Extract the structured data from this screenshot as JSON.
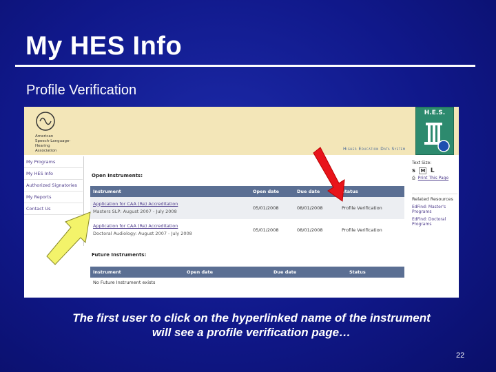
{
  "slide": {
    "title": "My HES Info",
    "subtitle": "Profile Verification",
    "caption_line1": "The first user to click on the hyperlinked name of the instrument",
    "caption_line2": "will see a profile verification page…",
    "page_number": "22"
  },
  "screenshot": {
    "org_text": [
      "American",
      "Speech-Language-",
      "Hearing",
      "Association"
    ],
    "tagline": "Higher Education Data System",
    "hes_logo": "H.E.S.",
    "sidebar": [
      "My Programs",
      "My HES Info",
      "Authorized Signatories",
      "My Reports",
      "Contact Us"
    ],
    "open_label": "Open Instruments:",
    "open_headers": [
      "Instrument",
      "Open date",
      "Due date",
      "Status"
    ],
    "open_rows": [
      {
        "link": "Application for CAA (Re) Accreditation",
        "sub": "Masters SLP: August 2007 - July 2008",
        "open": "05/01/2008",
        "due": "08/01/2008",
        "status": "Profile Verification"
      },
      {
        "link": "Application for CAA (Re) Accreditation",
        "sub": "Doctoral Audiology: August 2007 - July 2008",
        "open": "05/01/2008",
        "due": "08/01/2008",
        "status": "Profile Verification"
      }
    ],
    "future_label": "Future Instruments:",
    "future_headers": [
      "Instrument",
      "Open date",
      "Due date",
      "Status"
    ],
    "future_empty": "No Future Instrument exists",
    "text_size_label": "Text Size:",
    "text_sizes": [
      "S",
      "M",
      "L"
    ],
    "print_link": "Print This Page",
    "related_title": "Related Resources",
    "related_links": [
      "EdFind: Master's Programs",
      "EdFind: Doctoral Programs"
    ]
  },
  "colors": {
    "background": "#10188a",
    "header_band": "#f3e6b8",
    "table_header": "#5b6f93",
    "link": "#4c3a8a",
    "red_arrow": "#e8141b",
    "yellow_arrow": "#f3f36a"
  }
}
